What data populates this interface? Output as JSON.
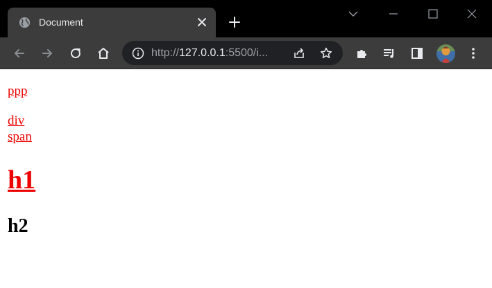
{
  "browser": {
    "tab": {
      "title": "Document",
      "favicon": "globe-icon",
      "close": "close-icon"
    },
    "new_tab": "plus-icon",
    "window_controls": [
      "chevron-down-icon",
      "minimize-icon",
      "maximize-icon",
      "close-icon"
    ],
    "toolbar": {
      "nav": [
        "back-arrow-icon",
        "forward-arrow-icon",
        "reload-icon",
        "home-icon"
      ],
      "address": {
        "prefix": "http://",
        "host": "127.0.0.1",
        "rest": ":5500/i..."
      },
      "address_icons": [
        "info-icon",
        "share-icon",
        "star-icon"
      ],
      "right_icons": [
        "extensions-puzzle-icon",
        "media-queue-icon",
        "side-panel-icon",
        "profile-avatar",
        "kebab-menu-icon"
      ]
    },
    "colors": {
      "frame": "#000000",
      "tab": "#3c3c3c",
      "toolbar": "#3c3c3c",
      "omnibox": "#202124",
      "text": "#e8eaed",
      "dim_text": "#9aa0a6"
    }
  },
  "page": {
    "links": {
      "ppp": "ppp",
      "div": "div",
      "span": "span",
      "h1": "h1"
    },
    "h2": "h2",
    "colors": {
      "link": "#ee0000",
      "text": "#000000",
      "background": "#ffffff"
    }
  }
}
